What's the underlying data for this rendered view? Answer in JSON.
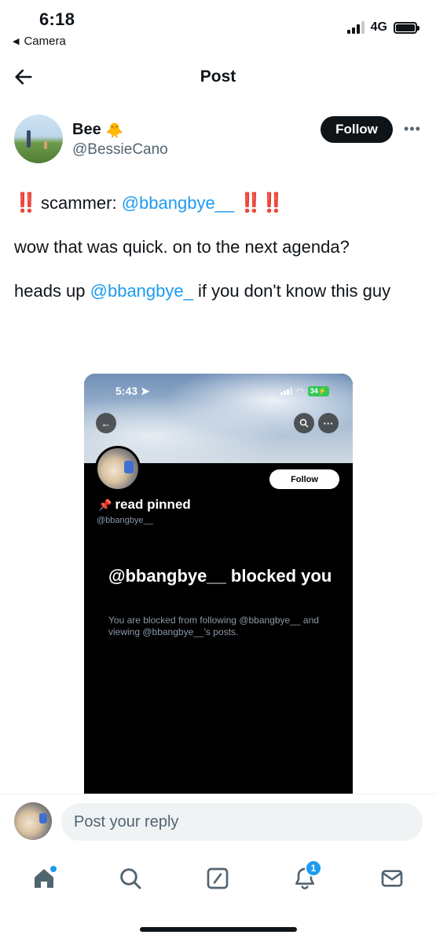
{
  "status_bar": {
    "time": "6:18",
    "back_app": "Camera",
    "network": "4G"
  },
  "header": {
    "title": "Post"
  },
  "author": {
    "name": "Bee",
    "name_emoji": "🐥",
    "handle": "@BessieCano",
    "follow_label": "Follow",
    "more_icon": "more-dots-icon"
  },
  "post": {
    "line1_prefix": "‼️",
    "line1_text": "scammer: ",
    "line1_mention": "@bbangbye__",
    "line1_suffix": "‼️‼️",
    "line2": "wow that was quick. on to the next agenda?",
    "line3_text": "heads up ",
    "line3_mention": "@bbangbye_",
    "line3_suffix": " if you don't know this guy"
  },
  "embedded_screenshot": {
    "time": "5:43",
    "battery": "34",
    "follow_label": "Follow",
    "name": "read pinned",
    "pin_emoji": "📌",
    "handle": "@bbangbye__",
    "blocked_title": "@bbangbye__ blocked you",
    "blocked_desc": "You are blocked from following @bbangbye__ and viewing @bbangbye__'s posts."
  },
  "reply": {
    "placeholder": "Post your reply"
  },
  "tab_bar": {
    "notifications_badge": "1",
    "accent": "#1d9bf0"
  }
}
